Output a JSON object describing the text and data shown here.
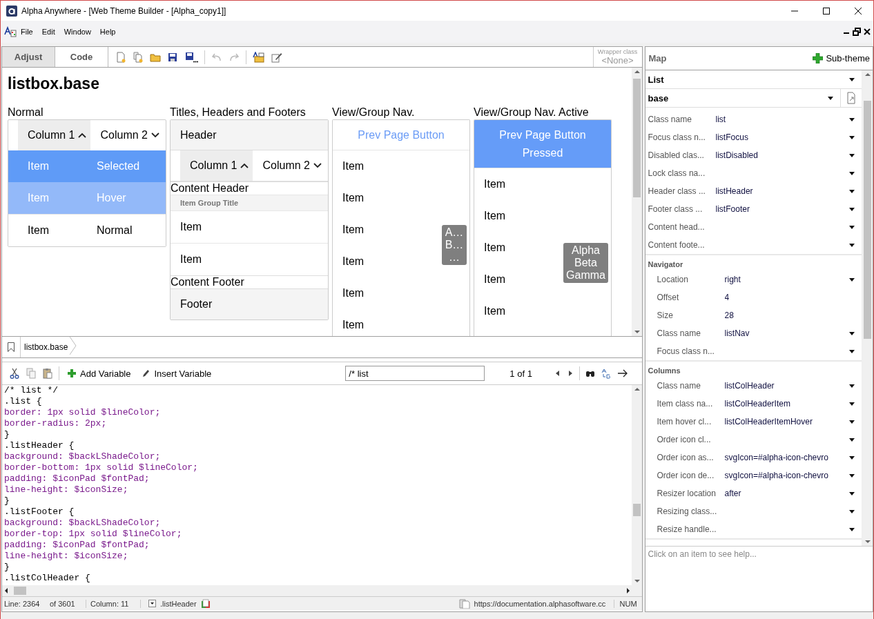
{
  "window": {
    "title": "Alpha Anywhere - [Web Theme Builder - [Alpha_copy1]]"
  },
  "menu": [
    "File",
    "Edit",
    "Window",
    "Help"
  ],
  "tabs": [
    {
      "label": "Adjust",
      "selected": false
    },
    {
      "label": "Code",
      "selected": true
    }
  ],
  "wrapper_class": {
    "label": "Wrapper class",
    "value": "<None>",
    "disabled": true
  },
  "preview": {
    "title": "listbox.base",
    "normal": {
      "label": "Normal",
      "columns": [
        {
          "label": "Column 1",
          "ascending": true,
          "highlighted": true
        },
        {
          "label": "Column 2",
          "ascending": false,
          "highlighted": false
        }
      ],
      "rows": [
        {
          "cells": [
            "Item",
            "Selected"
          ],
          "selected": true,
          "hover": false
        },
        {
          "cells": [
            "Item",
            "Hover"
          ],
          "selected": false,
          "hover": true
        },
        {
          "cells": [
            "Item",
            "Normal"
          ],
          "selected": false,
          "hover": false
        }
      ]
    },
    "titled": {
      "label": "Titles, Headers and Footers",
      "header": "Header",
      "columns": [
        {
          "label": "Column 1",
          "ascending": true,
          "highlighted": true
        },
        {
          "label": "Column 2",
          "ascending": false,
          "highlighted": false
        }
      ],
      "content_header": "Content Header",
      "group_title": "Item Group Title",
      "items": [
        "Item",
        "Item"
      ],
      "content_footer": "Content Footer",
      "footer": "Footer"
    },
    "nav_lists": [
      {
        "label": "View/Group Nav.",
        "button": "Prev Page Button",
        "pressed": false,
        "items": [
          "Item",
          "Item",
          "Item",
          "Item",
          "Item",
          "Item"
        ],
        "navigator": [
          "A…",
          "B…",
          "…"
        ]
      },
      {
        "label": "View/Group Nav. Active",
        "button": "Prev Page Button Pressed",
        "pressed": true,
        "items": [
          "Item",
          "Item",
          "Item",
          "Item",
          "Item"
        ],
        "navigator": [
          "Alpha",
          "Beta",
          "Gamma"
        ]
      }
    ]
  },
  "breadcrumb": "listbox.base",
  "code_toolbar": {
    "add": "Add Variable",
    "insert": "Insert Variable",
    "search": "/* list",
    "match": "1 of 1"
  },
  "code": [
    {
      "text": "/* list */",
      "kind": "comment"
    },
    {
      "text": ".list {",
      "kind": "selector"
    },
    {
      "text": "border: 1px solid $lineColor;",
      "kind": "property"
    },
    {
      "text": "border-radius: 2px;",
      "kind": "property"
    },
    {
      "text": "}",
      "kind": "selector"
    },
    {
      "text": ".listHeader {",
      "kind": "selector"
    },
    {
      "text": "background: $backLShadeColor;",
      "kind": "property"
    },
    {
      "text": "border-bottom: 1px solid $lineColor;",
      "kind": "property"
    },
    {
      "text": "padding: $iconPad $fontPad;",
      "kind": "property"
    },
    {
      "text": "line-height: $iconSize;",
      "kind": "property"
    },
    {
      "text": "}",
      "kind": "selector"
    },
    {
      "text": ".listFooter {",
      "kind": "selector"
    },
    {
      "text": "background: $backLShadeColor;",
      "kind": "property"
    },
    {
      "text": "border-top: 1px solid $lineColor;",
      "kind": "property"
    },
    {
      "text": "padding: $iconPad $fontPad;",
      "kind": "property"
    },
    {
      "text": "line-height: $iconSize;",
      "kind": "property"
    },
    {
      "text": "}",
      "kind": "selector"
    },
    {
      "text": ".listColHeader {",
      "kind": "selector"
    }
  ],
  "status": {
    "line": "Line: 2364",
    "of": "of 3601",
    "column": "Column: 11",
    "selector": ".listHeader",
    "url": "https://documentation.alphasoftware.cc",
    "num": "NUM"
  },
  "map": {
    "title": "Map",
    "subtheme": "Sub-theme",
    "component": "List",
    "style": "base",
    "groups": [
      {
        "rows": [
          {
            "label": "Class name",
            "value": "list",
            "dropdown": true
          },
          {
            "label": "Focus class n...",
            "value": "listFocus",
            "dropdown": true
          },
          {
            "label": "Disabled clas...",
            "value": "listDisabled",
            "dropdown": true
          },
          {
            "label": "Lock class na...",
            "value": "",
            "dropdown": true
          },
          {
            "label": "Header class ...",
            "value": "listHeader",
            "dropdown": true
          },
          {
            "label": "Footer class ...",
            "value": "listFooter",
            "dropdown": true
          },
          {
            "label": "Content head...",
            "value": "",
            "dropdown": true
          },
          {
            "label": "Content foote...",
            "value": "",
            "dropdown": true
          }
        ]
      },
      {
        "title": "Navigator",
        "rows": [
          {
            "label": "Location",
            "value": "right",
            "dropdown": true
          },
          {
            "label": "Offset",
            "value": "4",
            "dropdown": false
          },
          {
            "label": "Size",
            "value": "28",
            "dropdown": false
          },
          {
            "label": "Class name",
            "value": "listNav",
            "dropdown": true
          },
          {
            "label": "Focus class n...",
            "value": "",
            "dropdown": true
          }
        ]
      },
      {
        "title": "Columns",
        "rows": [
          {
            "label": "Class name",
            "value": "listColHeader",
            "dropdown": true
          },
          {
            "label": "Item class na...",
            "value": "listColHeaderItem",
            "dropdown": true
          },
          {
            "label": "Item hover cl...",
            "value": "listColHeaderItemHover",
            "dropdown": true
          },
          {
            "label": "Order icon cl...",
            "value": "",
            "dropdown": true
          },
          {
            "label": "Order icon as...",
            "value": "svgIcon=#alpha-icon-chevro",
            "dropdown": true
          },
          {
            "label": "Order icon de...",
            "value": "svgIcon=#alpha-icon-chevro",
            "dropdown": true
          },
          {
            "label": "Resizer location",
            "value": "after",
            "dropdown": true
          },
          {
            "label": "Resizing class...",
            "value": "",
            "dropdown": true
          },
          {
            "label": "Resize handle...",
            "value": "",
            "dropdown": true
          }
        ]
      }
    ],
    "help": "Click on an item to see help..."
  }
}
